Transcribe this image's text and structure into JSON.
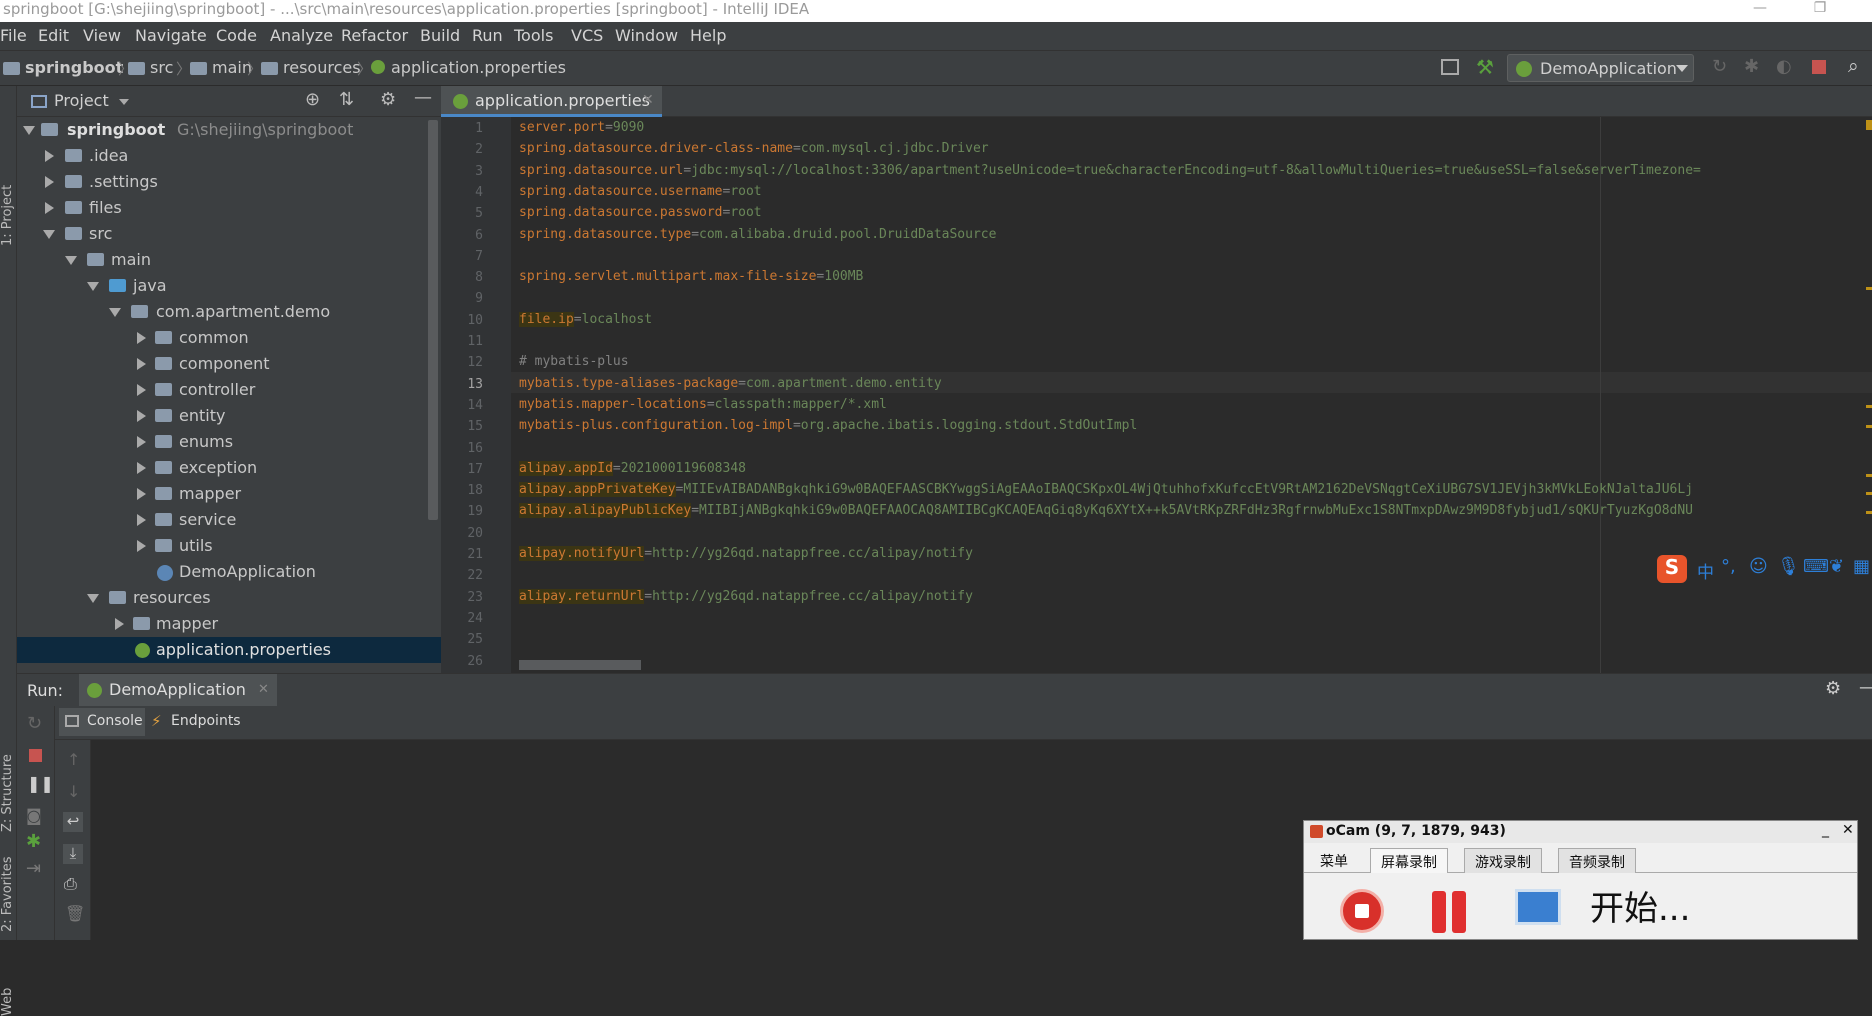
{
  "window": {
    "title": "springboot [G:\\shejiing\\springboot] - ...\\src\\main\\resources\\application.properties [springboot] - IntelliJ IDEA"
  },
  "menu": [
    "File",
    "Edit",
    "View",
    "Navigate",
    "Code",
    "Analyze",
    "Refactor",
    "Build",
    "Run",
    "Tools",
    "VCS",
    "Window",
    "Help"
  ],
  "breadcrumb": [
    "springboot",
    "src",
    "main",
    "resources",
    "application.properties"
  ],
  "run_config": "DemoApplication",
  "project_panel": {
    "title": "Project",
    "tree": [
      {
        "label": "springboot",
        "path": "G:\\shejiing\\springboot"
      },
      {
        "label": ".idea"
      },
      {
        "label": ".settings"
      },
      {
        "label": "files"
      },
      {
        "label": "src"
      },
      {
        "label": "main"
      },
      {
        "label": "java"
      },
      {
        "label": "com.apartment.demo"
      },
      {
        "label": "common"
      },
      {
        "label": "component"
      },
      {
        "label": "controller"
      },
      {
        "label": "entity"
      },
      {
        "label": "enums"
      },
      {
        "label": "exception"
      },
      {
        "label": "mapper"
      },
      {
        "label": "service"
      },
      {
        "label": "utils"
      },
      {
        "label": "DemoApplication"
      },
      {
        "label": "resources"
      },
      {
        "label": "mapper"
      },
      {
        "label": "application.properties"
      }
    ]
  },
  "side_stripes": {
    "project": "1: Project",
    "structure": "Z: Structure",
    "favorites": "2: Favorites",
    "web": "Web"
  },
  "editor": {
    "tab": "application.properties",
    "current_line": 13,
    "lines": [
      {
        "n": "1",
        "key": "server.port",
        "val": "9090"
      },
      {
        "n": "2",
        "key": "spring.datasource.driver-class-name",
        "val": "com.mysql.cj.jdbc.Driver"
      },
      {
        "n": "3",
        "key": "spring.datasource.url",
        "val": "jdbc:mysql://localhost:3306/apartment?useUnicode=true&characterEncoding=utf-8&allowMultiQueries=true&useSSL=false&serverTimezone="
      },
      {
        "n": "4",
        "key": "spring.datasource.username",
        "val": "root"
      },
      {
        "n": "5",
        "key": "spring.datasource.password",
        "val": "root"
      },
      {
        "n": "6",
        "key": "spring.datasource.type",
        "val": "com.alibaba.druid.pool.DruidDataSource"
      },
      {
        "n": "7",
        "key": "",
        "val": ""
      },
      {
        "n": "8",
        "key": "spring.servlet.multipart.max-file-size",
        "val": "100MB"
      },
      {
        "n": "9",
        "key": "",
        "val": ""
      },
      {
        "n": "10",
        "key": "file.ip",
        "val": "localhost"
      },
      {
        "n": "11",
        "key": "",
        "val": ""
      },
      {
        "n": "12",
        "comment": "# mybatis-plus"
      },
      {
        "n": "13",
        "key": "mybatis.type-aliases-package",
        "val": "com.apartment.demo.entity"
      },
      {
        "n": "14",
        "key": "mybatis.mapper-locations",
        "val": "classpath:mapper/*.xml"
      },
      {
        "n": "15",
        "key": "mybatis-plus.configuration.log-impl",
        "val": "org.apache.ibatis.logging.stdout.StdOutImpl"
      },
      {
        "n": "16",
        "key": "",
        "val": ""
      },
      {
        "n": "17",
        "key": "alipay.appId",
        "val": "2021000119608348"
      },
      {
        "n": "18",
        "key": "alipay.appPrivateKey",
        "val": "MIIEvAIBADANBgkqhkiG9w0BAQEFAASCBKYwggSiAgEAAoIBAQCSKpxOL4WjQtuhhofxKufccEtV9RtAM2162DeVSNqgtCeXiUBG7SV1JEVjh3kMVkLEokNJaltaJU6Lj"
      },
      {
        "n": "19",
        "key": "alipay.alipayPublicKey",
        "val": "MIIBIjANBgkqhkiG9w0BAQEFAAOCAQ8AMIIBCgKCAQEAqGiq8yKq6XYtX++k5AVtRKpZRFdHz3RgfrnwbMuExc1S8NTmxpDAwz9M9D8fybjud1/sQKUrTyuzKgO8dNU"
      },
      {
        "n": "20",
        "key": "",
        "val": ""
      },
      {
        "n": "21",
        "key": "alipay.notifyUrl",
        "val": "http://yg26qd.natappfree.cc/alipay/notify"
      },
      {
        "n": "22",
        "key": "",
        "val": ""
      },
      {
        "n": "23",
        "key": "alipay.returnUrl",
        "val": "http://yg26qd.natappfree.cc/alipay/notify"
      },
      {
        "n": "24",
        "key": "",
        "val": ""
      },
      {
        "n": "25",
        "key": "",
        "val": ""
      },
      {
        "n": "26",
        "key": "",
        "val": ""
      }
    ]
  },
  "run_panel": {
    "label": "Run:",
    "tab": "DemoApplication",
    "console_tab": "Console",
    "endpoints_tab": "Endpoints"
  },
  "ocam": {
    "title": "oCam (9, 7, 1879, 943)",
    "tabs": [
      "菜单",
      "屏幕录制",
      "游戏录制",
      "音频录制"
    ],
    "active_tab": "屏幕录制",
    "start_text": "开始..."
  },
  "ime": {
    "brand": "S",
    "mode": "中"
  },
  "colors": {
    "background": "#2b2b2b",
    "panel": "#3c3f41",
    "key": "#cc7832",
    "value": "#6a8759",
    "selection": "#0d293e",
    "accent": "#4a88c7"
  }
}
